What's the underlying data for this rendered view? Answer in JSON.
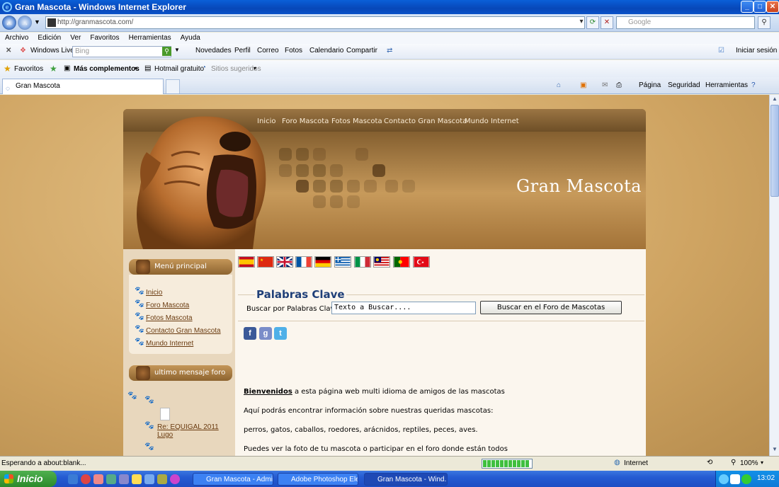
{
  "window": {
    "title": "Gran Mascota - Windows Internet Explorer",
    "minimize": "_",
    "maximize": "□",
    "close": "✕"
  },
  "address": {
    "url": "http://granmascota.com/",
    "search_placeholder": "Google"
  },
  "menu": [
    "Archivo",
    "Edición",
    "Ver",
    "Favoritos",
    "Herramientas",
    "Ayuda"
  ],
  "live_bar": {
    "brand": "Windows Live",
    "search_placeholder": "Bing",
    "links": [
      "Novedades",
      "Perfil",
      "Correo",
      "Fotos",
      "Calendario",
      "Compartir"
    ],
    "signin": "Iniciar sesión"
  },
  "fav_bar": {
    "favorites": "Favoritos",
    "more": "Más complementos",
    "hotmail": "Hotmail gratuito",
    "suggested": "Sitios sugeridos"
  },
  "tabs": {
    "active": "Gran Mascota",
    "commands": [
      "Página",
      "Seguridad",
      "Herramientas"
    ]
  },
  "site": {
    "nav": [
      "Inicio",
      "Foro Mascota",
      "Fotos Mascota",
      "Contacto Gran Mascota",
      "Mundo Internet"
    ],
    "title": "Gran Mascota",
    "menu_title": "Menú principal",
    "menu_links": [
      "Inicio",
      "Foro Mascota",
      "Fotos Mascota",
      "Contacto Gran Mascota",
      "Mundo Internet"
    ],
    "forum_title": "ultimo mensaje foro",
    "forum_link": "Re: EQUIGAL 2011 Lugo",
    "search": {
      "legend": "Palabras Clave",
      "label": "Buscar por Palabras Clave:",
      "value": "Texto a Buscar....",
      "button": "Buscar en el Foro de Mascotas"
    },
    "welcome_bold": "Bienvenidos",
    "welcome_rest": " a esta página web multi idioma de amigos de las mascotas",
    "p1": "Aquí podrás encontrar información sobre nuestras queridas mascotas:",
    "p2": "perros, gatos, caballos, roedores, arácnidos, reptiles, peces, aves.",
    "p3": "Puedes ver la foto de tu mascota o participar en el foro donde están todos"
  },
  "status": {
    "text": "Esperando a about:blank...",
    "zone": "Internet",
    "zoom": "100%",
    "progress": 0.95
  },
  "taskbar": {
    "start": "Inicio",
    "tasks": [
      "Gran Mascota - Admi...",
      "Adobe Photoshop Ele...",
      "Gran Mascota - Wind..."
    ],
    "clock": "13:02"
  }
}
